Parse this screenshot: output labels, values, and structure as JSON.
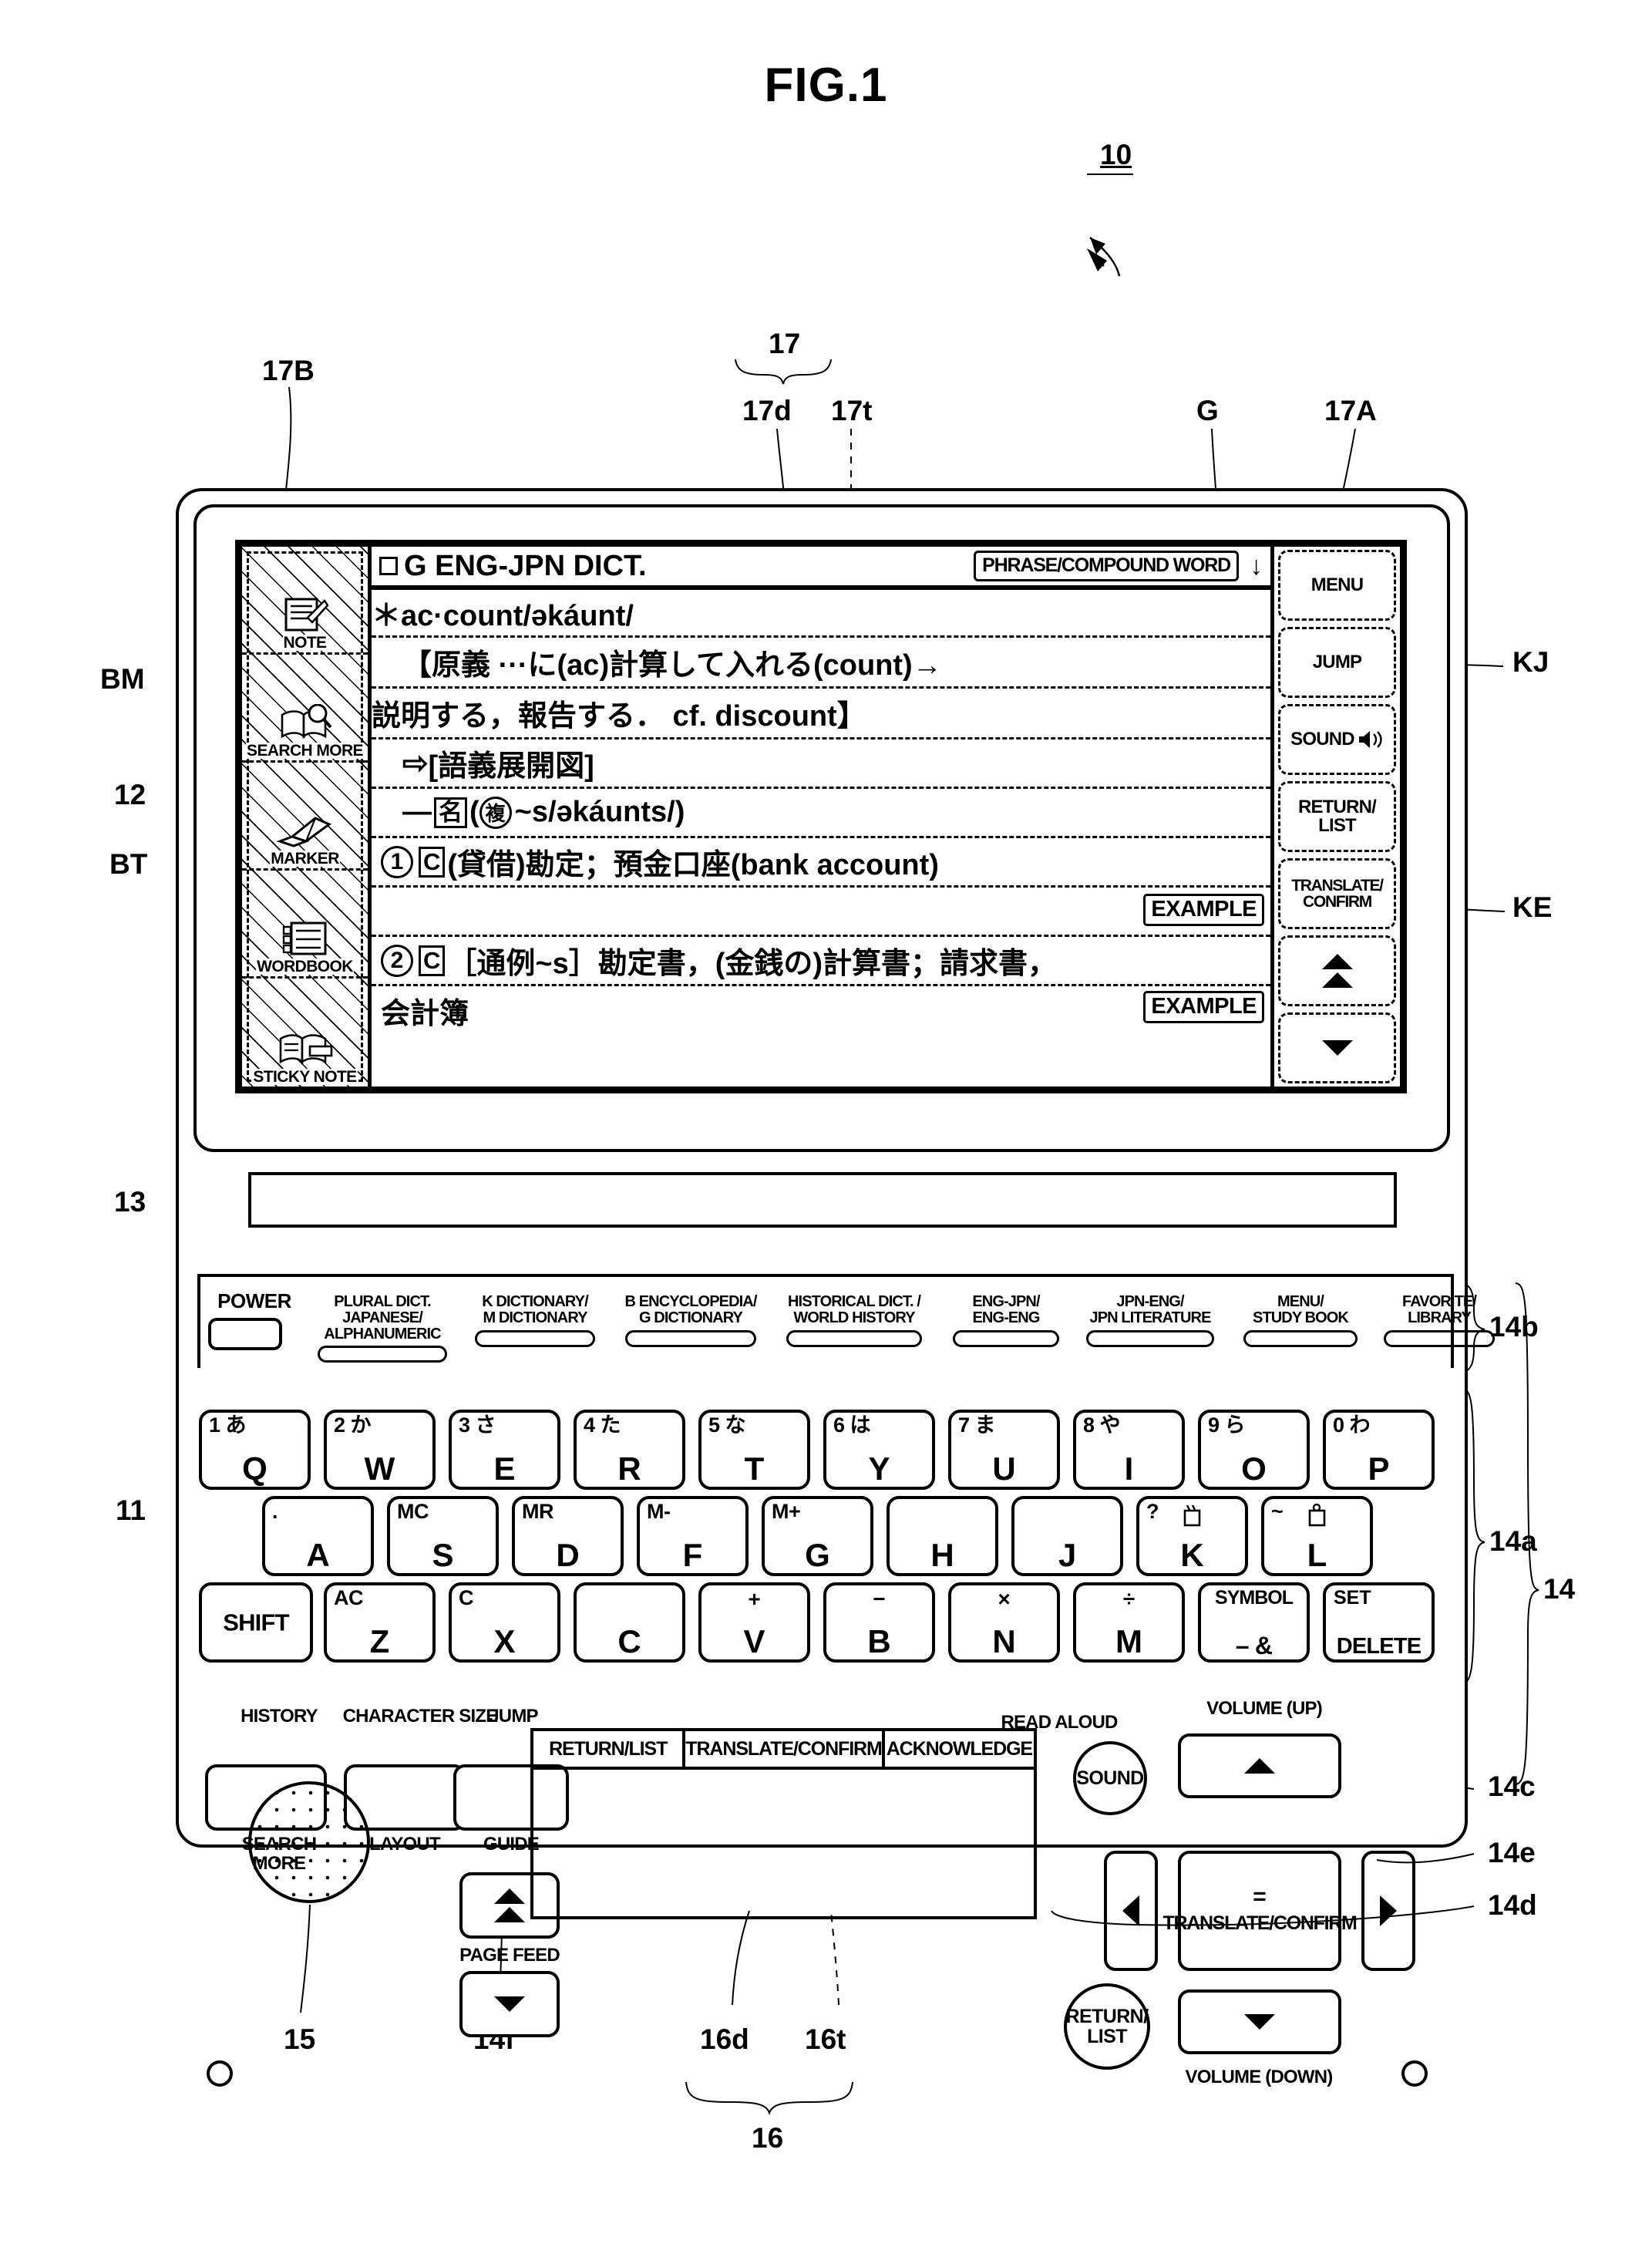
{
  "figure": {
    "title": "FIG.1"
  },
  "refs": {
    "device": "10",
    "display_assembly": "17",
    "display_area": "17d",
    "touch_panel": "17t",
    "left_icon_bar": "17B",
    "right_key_bar": "17A",
    "g_mark": "G",
    "jump_key": "KJ",
    "translate_key": "KE",
    "marker_button": "BM",
    "wordbook_button": "BT",
    "icon_bar_group": "12",
    "lower_case": "11",
    "hinge": "13",
    "keyboard": "14",
    "char_keys": "14a",
    "dict_keys": "14b",
    "volume_up": "14c",
    "volume_down": "14d",
    "cursor_right": "14e",
    "page_feed": "14f",
    "trackpad": "15",
    "sub_display_assembly": "16",
    "sub_display_area": "16d",
    "sub_touch_panel": "16t"
  },
  "lcd": {
    "title_bar": {
      "dictionary_name": "G ENG-JPN DICT.",
      "phrase_tag": "PHRASE/COMPOUND WORD",
      "scroll_arrow": "↓"
    },
    "left_icons": [
      {
        "label": "NOTE",
        "icon": "note-page-icon"
      },
      {
        "label": "SEARCH MORE",
        "icon": "book-magnifier-icon"
      },
      {
        "label": "MARKER",
        "icon": "highlighter-pen-icon"
      },
      {
        "label": "WORDBOOK",
        "icon": "checklist-page-icon"
      },
      {
        "label": "STICKY NOTE",
        "icon": "book-sticky-note-icon"
      }
    ],
    "entry": {
      "headword": "＊ac·count/əkáunt/",
      "line_gloss_1": "【原義 ···に(ac)計算して入れる(count)→",
      "line_gloss_2": "説明する，報告する． cf. discount】",
      "line_diagram": "[語義展開図]",
      "line_diagram_arrow": "⇨",
      "pos_dash": "—",
      "pos_box": "名",
      "plural_box": "複",
      "plural_form": "~s/əkáunts/)",
      "plural_open": "(",
      "sense1_num": "1",
      "sense1_box": "C",
      "sense1_text": "(貸借)勘定；預金口座(bank account)",
      "sense2_num": "2",
      "sense2_box": "C",
      "sense2_text": "［通例~s］勘定書，(金銭の)計算書；請求書，",
      "sense2_cont": "会計簿",
      "example_tag": "EXAMPLE"
    },
    "right_keys": [
      {
        "label": "MENU",
        "icon": ""
      },
      {
        "label": "JUMP",
        "icon": ""
      },
      {
        "label": "SOUND",
        "icon": "speaker-icon"
      },
      {
        "label": "RETURN/\nLIST",
        "icon": ""
      },
      {
        "label": "TRANSLATE/\nCONFIRM",
        "icon": ""
      },
      {
        "label": "",
        "icon": "double-up-arrow-icon"
      },
      {
        "label": "",
        "icon": "double-down-arrow-icon"
      }
    ]
  },
  "keyboard": {
    "power_label": "POWER",
    "dict_keys": [
      "PLURAL DICT. JAPANESE/\nALPHANUMERIC",
      "K DICTIONARY/\nM DICTIONARY",
      "B ENCYCLOPEDIA/\nG DICTIONARY",
      "HISTORICAL DICT. /\nWORLD HISTORY",
      "ENG-JPN/\nENG-ENG",
      "JPN-ENG/\nJPN LITERATURE",
      "MENU/\nSTUDY BOOK",
      "FAVORITE/\nLIBRARY"
    ],
    "row1": [
      {
        "sup": "1 あ",
        "main": "Q"
      },
      {
        "sup": "2 か",
        "main": "W"
      },
      {
        "sup": "3 さ",
        "main": "E"
      },
      {
        "sup": "4 た",
        "main": "R"
      },
      {
        "sup": "5 な",
        "main": "T"
      },
      {
        "sup": "6 は",
        "main": "Y"
      },
      {
        "sup": "7 ま",
        "main": "U"
      },
      {
        "sup": "8 や",
        "main": "I"
      },
      {
        "sup": "9 ら",
        "main": "O"
      },
      {
        "sup": "0 わ",
        "main": "P"
      }
    ],
    "row2": [
      {
        "sup": ".",
        "main": "A"
      },
      {
        "sup": "MC",
        "main": "S"
      },
      {
        "sup": "MR",
        "main": "D"
      },
      {
        "sup": "M-",
        "main": "F"
      },
      {
        "sup": "M+",
        "main": "G"
      },
      {
        "sup": "",
        "main": "H"
      },
      {
        "sup": "",
        "main": "J"
      },
      {
        "sup": "?",
        "main": "K",
        "extra": "dakuten"
      },
      {
        "sup": "~",
        "main": "L",
        "extra": "handakuten"
      }
    ],
    "row3": [
      {
        "sup": "",
        "main": "SHIFT",
        "wide": true
      },
      {
        "sup": "AC",
        "main": "Z"
      },
      {
        "sup": "C",
        "main": "X"
      },
      {
        "sup": "",
        "main": "C"
      },
      {
        "sup": "+",
        "main": "V"
      },
      {
        "sup": "−",
        "main": "B"
      },
      {
        "sup": "×",
        "main": "N"
      },
      {
        "sup": "÷",
        "main": "M"
      },
      {
        "sup": "SYMBOL",
        "main": "– &",
        "two": true
      },
      {
        "sup": "SET",
        "main": "DELETE",
        "two": true
      }
    ]
  },
  "controls": {
    "history": "HISTORY",
    "search_more": "SEARCH\nMORE",
    "character_size": "CHARACTER SIZE",
    "layout": "LAYOUT",
    "jump": "JUMP",
    "guide": "GUIDE",
    "page_feed": "PAGE FEED",
    "read_aloud": "READ ALOUD",
    "sound": "SOUND",
    "volume_up": "VOLUME (UP)",
    "volume_down": "VOLUME (DOWN)",
    "translate_confirm": "TRANSLATE/CONFIRM",
    "translate_equals": "=",
    "return_list": "RETURN/\nLIST"
  },
  "sub_display": {
    "tabs": [
      "RETURN/LIST",
      "TRANSLATE/CONFIRM",
      "ACKNOWLEDGE"
    ]
  }
}
